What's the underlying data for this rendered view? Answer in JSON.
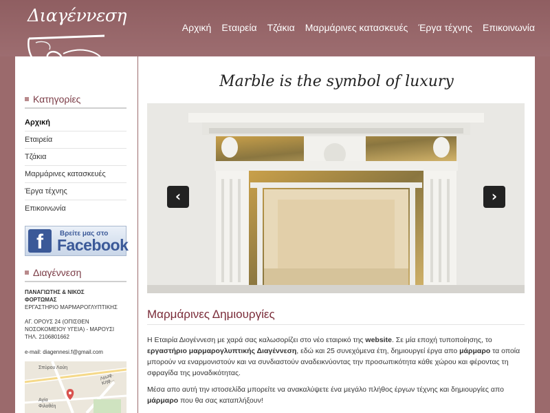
{
  "header": {
    "logo_text": "Διαγέννεση",
    "nav": [
      "Αρχική",
      "Εταιρεία",
      "Τζάκια",
      "Μαρμάρινες κατασκευές",
      "Έργα τέχνης",
      "Επικοινωνία"
    ]
  },
  "sidebar": {
    "categories_title": "Κατηγορίες",
    "menu": [
      "Αρχική",
      "Εταιρεία",
      "Τζάκια",
      "Μαρμάρινες κατασκευές",
      "Έργα τέχνης",
      "Επικοινωνία"
    ],
    "facebook_small": "Βρείτε μας στο",
    "facebook_big": "Facebook",
    "about_title": "Διαγέννεση",
    "contact_name_1": "ΠΑΝΑΓΙΩΤΗΣ & ΝΙΚΟΣ",
    "contact_name_2": "ΦΟΡΤΩΜΑΣ",
    "contact_workshop": "ΕΡΓΑΣΤΗΡΙΟ ΜΑΡΜΑΡΟΓΛΥΠΤΙΚΗΣ",
    "contact_address_1": "ΑΓ. ΟΡΟΥΣ 24 (ΟΠΙΣΘΕΝ",
    "contact_address_2": "ΝΟΣΟΚΟΜΕΙΟΥ ΥΓΕΙΑ) - ΜΑΡΟΥΣΙ",
    "contact_phone": "ΤΗΛ. 2106801662",
    "contact_email": "e-mail: diagennesi.f@gmail.com",
    "map_label_1": "Αγία",
    "map_label_2": "Φιλοθέη",
    "map_street_1": "Λεωφ. Κηφ...",
    "map_street_2": "Σπύρου Λούη"
  },
  "main": {
    "tagline": "Marble is the symbol of luxury",
    "slider_prev": "‹",
    "slider_next": "›",
    "section_title": "Μαρμάρινες Δημιουργίες",
    "p1_a": "Η Εταιρία Διογέννεση με χαρά σας καλωσορίζει στο νέο εταιρικό της ",
    "p1_b": "website",
    "p1_c": ". Σε μία εποχή τυποποίησης, το ",
    "p1_d": "εργαστήριο μαρμαρογλυπτικής Διαγέννεση",
    "p1_e": ", εδώ και 25 συνεχόμενα έτη, δημιουργεί έργα απο ",
    "p1_f": "μάρμαρο",
    "p1_g": " τα οποία μπορούν να εναρμονιστούν και να συνδιαστούν αναδεικνύοντας την προσωπικότητα κάθε χώρου και φέροντας τη σφραγίδα της μοναδικότητας.",
    "p2_a": "Μέσα απο αυτή την ιστοσελίδα μπορείτε να ανακαλύψετε ένα μεγάλο πλήθος έργων τέχνης και δημιουργίες απο ",
    "p2_b": "μάρμαρο",
    "p2_c": " που θα σας καταπλήξουν!"
  }
}
